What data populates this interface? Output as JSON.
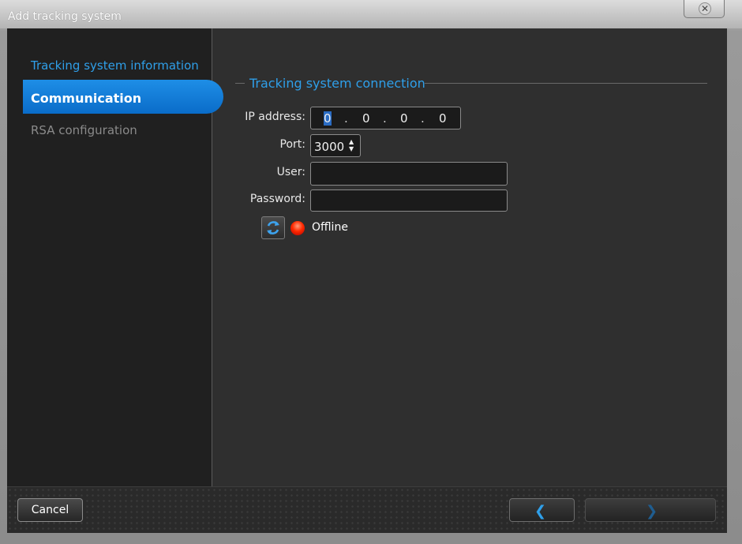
{
  "window": {
    "title": "Add tracking system",
    "close_icon": "close-icon"
  },
  "sidebar": {
    "items": [
      {
        "label": "Tracking system information",
        "state": "visited"
      },
      {
        "label": "Communication",
        "state": "active"
      },
      {
        "label": "RSA configuration",
        "state": "disabled"
      }
    ]
  },
  "connection": {
    "section_title": "Tracking system connection",
    "ip_label": "IP address:",
    "ip_octets": [
      "0",
      "0",
      "0",
      "0"
    ],
    "port_label": "Port:",
    "port_value": "3000",
    "user_label": "User:",
    "user_value": "",
    "password_label": "Password:",
    "password_value": "",
    "refresh_icon": "refresh-icon",
    "status_text": "Offline",
    "status_color": "#ff2a00"
  },
  "footer": {
    "cancel_label": "Cancel",
    "back_icon": "chevron-left-icon",
    "next_icon": "chevron-right-icon"
  },
  "colors": {
    "accent": "#2f9fe9",
    "active_nav": "#1a86df"
  }
}
